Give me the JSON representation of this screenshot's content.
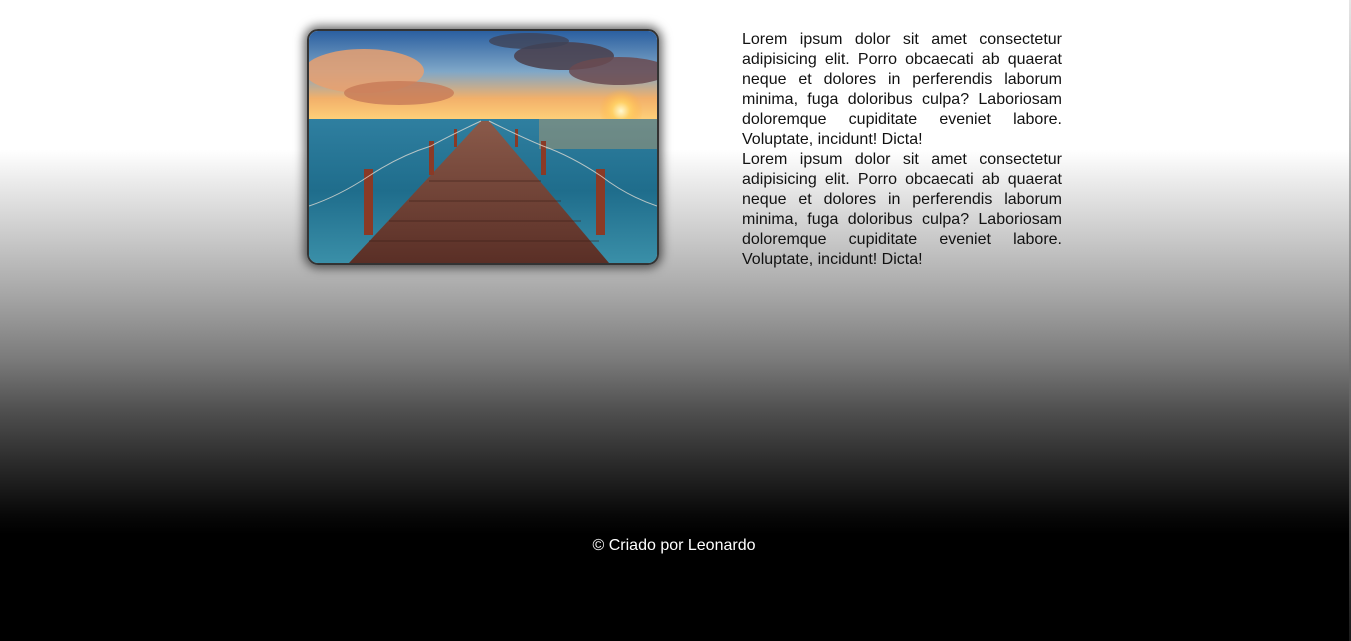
{
  "content": {
    "image": {
      "icon": "pier-sunset-photo",
      "alt": ""
    },
    "paragraphs": [
      "Lorem ipsum dolor sit amet consectetur adipisicing elit. Porro obcaecati ab quaerat neque et dolores in perferendis laborum minima, fuga doloribus culpa? Laboriosam doloremque cupiditate eveniet labore. Voluptate, incidunt! Dicta!",
      "Lorem ipsum dolor sit amet consectetur adipisicing elit. Porro obcaecati ab quaerat neque et dolores in perferendis laborum minima, fuga doloribus culpa? Laboriosam doloremque cupiditate eveniet labore. Voluptate, incidunt! Dicta!"
    ]
  },
  "footer": {
    "text": "© Criado por Leonardo"
  },
  "colors": {
    "page_top": "#ffffff",
    "page_bottom": "#000000",
    "body_text": "#111111",
    "footer_text": "#ffffff"
  }
}
